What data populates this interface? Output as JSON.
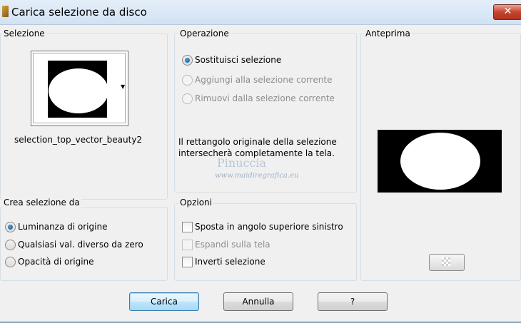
{
  "window": {
    "title": "Carica selezione da disco",
    "close_label": "✕"
  },
  "selezione": {
    "label": "Selezione",
    "filename": "selection_top_vector_beauty2"
  },
  "operazione": {
    "label": "Operazione",
    "options": [
      {
        "label": "Sostituisci selezione",
        "checked": true,
        "enabled": true
      },
      {
        "label": "Aggiungi alla selezione corrente",
        "checked": false,
        "enabled": false
      },
      {
        "label": "Rimuovi dalla selezione corrente",
        "checked": false,
        "enabled": false
      }
    ],
    "info_line1": "Il rettangolo originale della selezione",
    "info_line2": "intersecherà completamente la tela."
  },
  "watermark": {
    "name": "Pinuccia",
    "site": "www.maidiregrafica.eu"
  },
  "anteprima": {
    "label": "Anteprima",
    "zoom_icon": "checkerboard-icon"
  },
  "crea": {
    "label": "Crea selezione da",
    "options": [
      {
        "label": "Luminanza di origine",
        "checked": true
      },
      {
        "label": "Qualsiasi val. diverso da zero",
        "checked": false
      },
      {
        "label": "Opacità di origine",
        "checked": false
      }
    ]
  },
  "opzioni": {
    "label": "Opzioni",
    "options": [
      {
        "label": "Sposta in angolo superiore sinistro",
        "checked": false,
        "enabled": true
      },
      {
        "label": "Espandi sulla tela",
        "checked": false,
        "enabled": false
      },
      {
        "label": "Inverti selezione",
        "checked": false,
        "enabled": true
      }
    ]
  },
  "buttons": {
    "load": "Carica",
    "cancel": "Annulla",
    "help": "?"
  }
}
